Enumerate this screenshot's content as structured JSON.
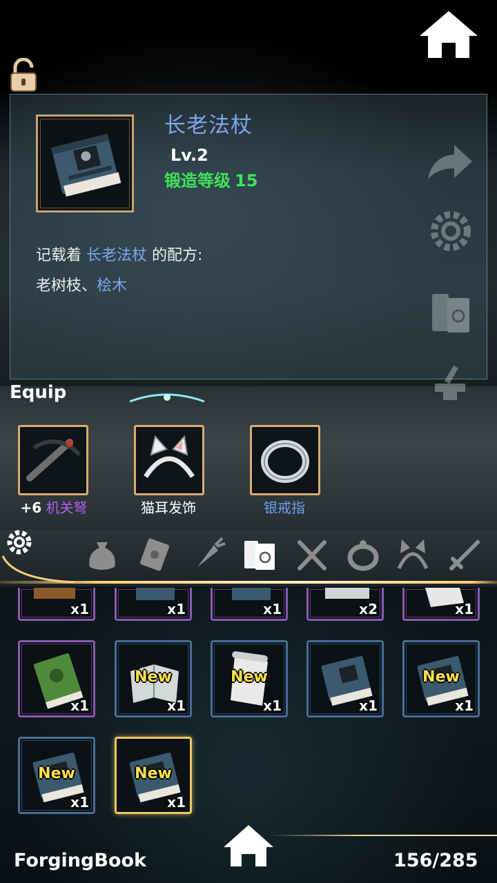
{
  "item": {
    "name": "长老法杖",
    "level": "Lv.2",
    "forge_label": "锻造等级",
    "forge_value": "15",
    "desc_prefix": "记载着",
    "desc_item": "长老法杖",
    "desc_suffix": "的配方:",
    "recipe_part1": "老树枝、",
    "recipe_part2": "桧木"
  },
  "equip": {
    "title": "Equip",
    "slots": [
      {
        "prefix": "+6",
        "label": "机关弩",
        "color": "#b35ef0"
      },
      {
        "prefix": "",
        "label": "猫耳发饰",
        "color": "#ffffff"
      },
      {
        "prefix": "",
        "label": "银戒指",
        "color": "#6d9ff0"
      }
    ]
  },
  "categories": [
    "bag-icon",
    "scroll-card-icon",
    "carrot-icon",
    "book-icon",
    "fork-knife-icon",
    "ring-icon",
    "cat-ear-icon",
    "sword-icon"
  ],
  "grid": {
    "row1": [
      {
        "qty": "x1",
        "frame": "purple"
      },
      {
        "qty": "x1",
        "frame": "purple"
      },
      {
        "qty": "x1",
        "frame": "purple"
      },
      {
        "qty": "x2",
        "frame": "purple"
      },
      {
        "qty": "x1",
        "frame": "purple"
      }
    ],
    "row2": [
      {
        "qty": "x1",
        "frame": "purple",
        "new": ""
      },
      {
        "qty": "x1",
        "frame": "blue",
        "new": "New"
      },
      {
        "qty": "x1",
        "frame": "blue",
        "new": "New"
      },
      {
        "qty": "x1",
        "frame": "blue",
        "new": ""
      },
      {
        "qty": "x1",
        "frame": "blue",
        "new": "New"
      }
    ],
    "row3": [
      {
        "qty": "x1",
        "frame": "blue",
        "new": "New"
      },
      {
        "qty": "x1",
        "frame": "gold",
        "new": "New"
      }
    ]
  },
  "footer": {
    "title": "ForgingBook",
    "count": "156/285"
  },
  "colors": {
    "accent_gold": "#f0c562",
    "name_blue": "#7fa6ea",
    "forge_green": "#3fe35a",
    "new_yellow": "#ffe24a"
  }
}
